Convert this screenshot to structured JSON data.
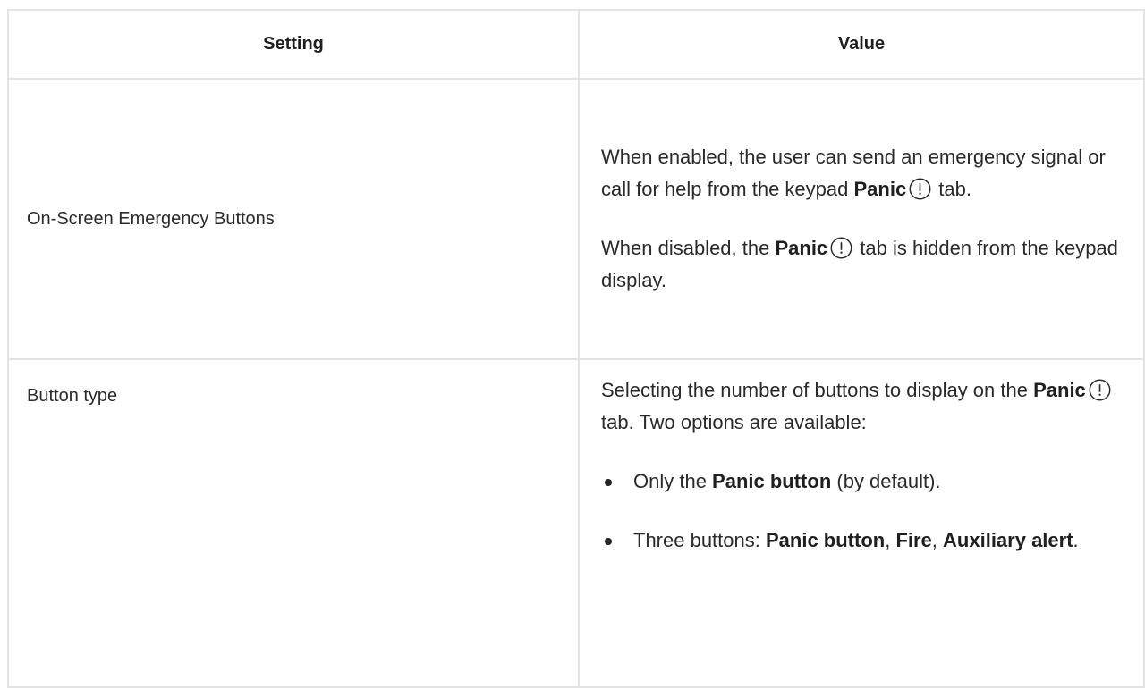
{
  "table": {
    "headers": {
      "setting": "Setting",
      "value": "Value"
    },
    "rows": [
      {
        "setting": "On-Screen Emergency Buttons",
        "value": {
          "p1_before": "When enabled, the user can send an emergency signal or call for help from the keypad ",
          "p1_bold": "Panic",
          "p1_after": " tab.",
          "p2_before": "When disabled, the ",
          "p2_bold": "Panic",
          "p2_after": " tab is hidden from the keypad display."
        }
      },
      {
        "setting": "Button type",
        "value": {
          "intro_before": "Selecting the number of buttons to display on the ",
          "intro_bold": "Panic",
          "intro_after": " tab. Two options are available:",
          "bullet1_before": "Only the ",
          "bullet1_bold": "Panic button",
          "bullet1_after": " (by default).",
          "bullet2_before": "Three buttons: ",
          "bullet2_bold1": "Panic button",
          "bullet2_sep1": ", ",
          "bullet2_bold2": "Fire",
          "bullet2_sep2": ", ",
          "bullet2_bold3": "Auxiliary alert",
          "bullet2_after": "."
        }
      }
    ]
  },
  "icons": {
    "panic": "panic-exclamation-icon"
  },
  "colors": {
    "border": "#e3e3e3",
    "text": "#2a2a2a",
    "header_text": "#1f1f1f"
  }
}
